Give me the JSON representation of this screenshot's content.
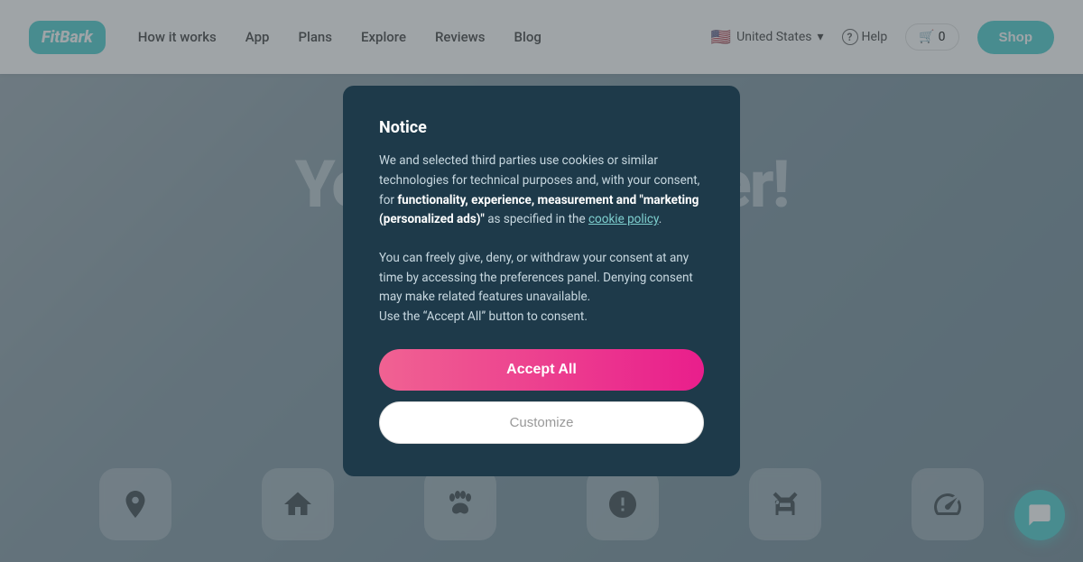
{
  "brand": {
    "name": "FitBark"
  },
  "nav": {
    "links": [
      {
        "label": "How it works",
        "id": "how-it-works"
      },
      {
        "label": "App",
        "id": "app"
      },
      {
        "label": "Plans",
        "id": "plans"
      },
      {
        "label": "Explore",
        "id": "explore"
      },
      {
        "label": "Reviews",
        "id": "reviews"
      },
      {
        "label": "Blog",
        "id": "blog"
      }
    ],
    "country": "United States",
    "help": "Help",
    "cart_count": "0",
    "shop": "Shop"
  },
  "hero": {
    "headline": "Your Al... Tracker!"
  },
  "modal": {
    "title": "Notice",
    "body_intro": "We and selected third parties use cookies or similar technologies for technical purposes and, with your consent, for ",
    "body_bold": "functionality, experience, measurement and “marketing (personalized ads)”",
    "body_mid": " as specified in the ",
    "cookie_link": "cookie policy",
    "body_end": ".",
    "body_line2": "You can freely give, deny, or withdraw your consent at any time by accessing the preferences panel. Denying consent may make related features unavailable.",
    "body_line3": "Use the “Accept All” button to consent.",
    "accept_label": "Accept All",
    "customize_label": "Customize"
  },
  "bottom_icons": [
    {
      "name": "location-icon",
      "title": "GPS"
    },
    {
      "name": "home-icon",
      "title": "Home"
    },
    {
      "name": "paw-icon",
      "title": "Activity"
    },
    {
      "name": "alert-icon",
      "title": "Alert"
    },
    {
      "name": "dog-icon",
      "title": "Dog"
    },
    {
      "name": "speed-icon",
      "title": "Speed"
    }
  ]
}
